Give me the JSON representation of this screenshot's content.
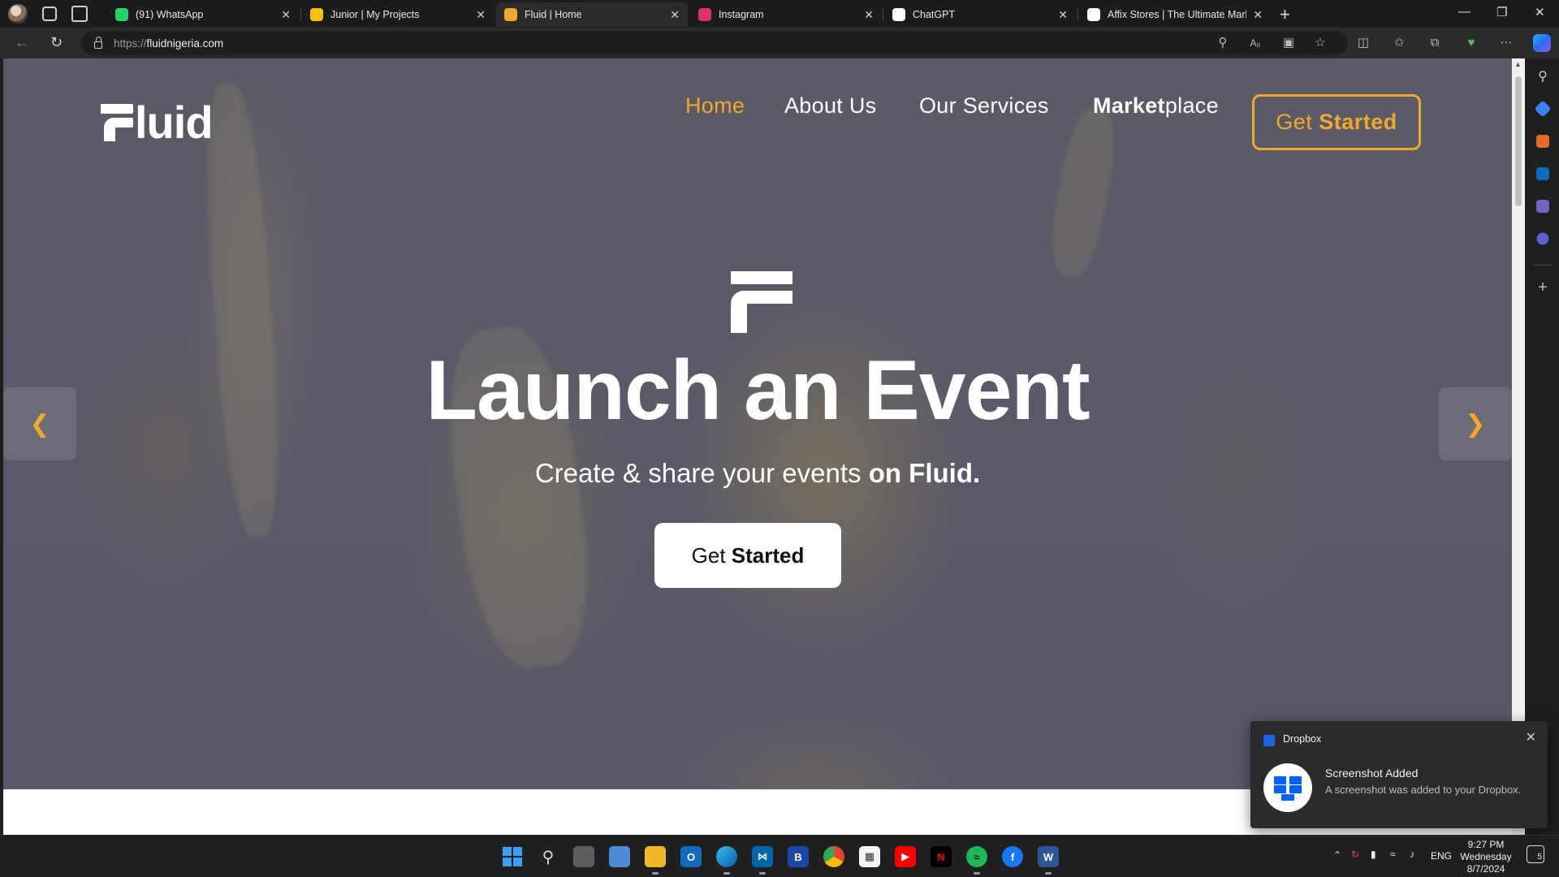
{
  "browser": {
    "tabs": [
      {
        "title": "(91) WhatsApp",
        "favicon": "whatsapp-icon",
        "color": "#25d366"
      },
      {
        "title": "Junior | My Projects",
        "favicon": "folder-icon",
        "color": "#f4c20d"
      },
      {
        "title": "Fluid | Home",
        "favicon": "fluid-icon",
        "color": "#f0a92a",
        "active": true
      },
      {
        "title": "Instagram",
        "favicon": "instagram-icon",
        "color": "#e1306c"
      },
      {
        "title": "ChatGPT",
        "favicon": "chatgpt-icon",
        "color": "#ffffff"
      },
      {
        "title": "Affix Stores | The Ultimate Marke",
        "favicon": "affix-icon",
        "color": "#ffffff"
      }
    ],
    "url_scheme": "https://",
    "url_host": "fluidnigeria.com"
  },
  "site": {
    "logo_text": "luid",
    "nav": {
      "home": "Home",
      "about": "About Us",
      "services": "Our Services",
      "market_bold": "Market",
      "market_rest": "place",
      "cta_regular": "Get ",
      "cta_bold": "Started"
    },
    "hero": {
      "title": "Launch an Event",
      "subtitle_regular": "Create & share your events ",
      "subtitle_bold": "on Fluid.",
      "button_regular": "Get ",
      "button_bold": "Started"
    },
    "accent_color": "#f0a92a"
  },
  "toast": {
    "app": "Dropbox",
    "title": "Screenshot Added",
    "body": "A screenshot was added to your Dropbox."
  },
  "taskbar": {
    "tray_lang": "ENG",
    "time": "9:27 PM",
    "day": "Wednesday",
    "date": "8/7/2024",
    "notification_count": "5"
  }
}
